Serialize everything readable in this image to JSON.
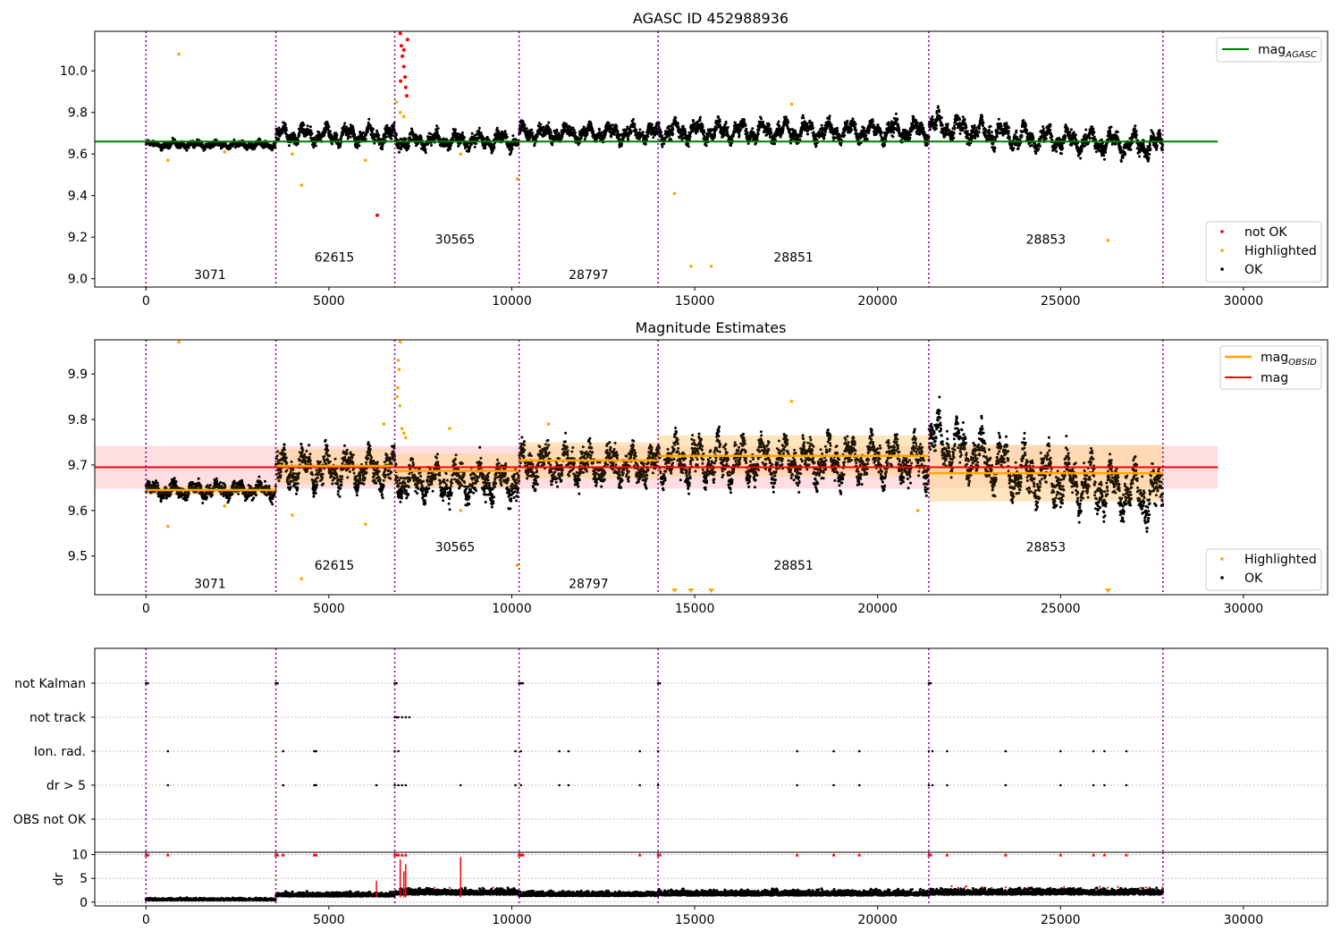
{
  "colors": {
    "ok": "#000000",
    "highlighted": "#FFA500",
    "not_ok": "#FF0000",
    "mag_agasc_line": "#008000",
    "mag_line": "#FF0000",
    "mag_obsid_line": "#FFA500",
    "band_mag": "#FFB6BE",
    "band_obsid": "#FFE3BF",
    "obs_separator": "#800080",
    "grid": "#b0b0b0"
  },
  "chart_data": [
    {
      "id": "agasc",
      "type": "scatter",
      "title": "AGASC ID 452988936",
      "xlim": [
        -1400,
        32300
      ],
      "ylim": [
        8.96,
        10.19
      ],
      "xticks": [
        0,
        5000,
        10000,
        15000,
        20000,
        25000,
        30000
      ],
      "yticks": [
        9.0,
        9.2,
        9.4,
        9.6,
        9.8,
        10.0
      ],
      "ytick_labels": [
        "9.0",
        "9.2",
        "9.4",
        "9.6",
        "9.8",
        "10.0"
      ],
      "obs_boundaries": [
        0,
        3550,
        6800,
        10200,
        14000,
        21400,
        27800
      ],
      "obs_labels": [
        {
          "text": "3071",
          "x": 1750,
          "y": 9.02
        },
        {
          "text": "62615",
          "x": 5150,
          "y": 9.105
        },
        {
          "text": "30565",
          "x": 8450,
          "y": 9.19
        },
        {
          "text": "28797",
          "x": 12100,
          "y": 9.02
        },
        {
          "text": "28851",
          "x": 17700,
          "y": 9.105
        },
        {
          "text": "28853",
          "x": 24600,
          "y": 9.19
        }
      ],
      "mag_agasc": 9.66,
      "mag_agasc_span": [
        -1400,
        29300
      ],
      "segments": [
        {
          "x0": 0,
          "x1": 3550,
          "base": 9.645,
          "amp": 0.015,
          "noise": 0.02
        },
        {
          "x0": 3550,
          "x1": 6800,
          "base": 9.69,
          "amp": 0.045,
          "noise": 0.04
        },
        {
          "x0": 6800,
          "x1": 10200,
          "base": 9.665,
          "amp": 0.04,
          "noise": 0.04
        },
        {
          "x0": 10200,
          "x1": 14000,
          "base": 9.7,
          "amp": 0.04,
          "noise": 0.04
        },
        {
          "x0": 14000,
          "x1": 21400,
          "base": 9.71,
          "amp": 0.05,
          "noise": 0.045
        },
        {
          "x0": 21400,
          "x1": 27800,
          "base": 9.68,
          "amp": 0.06,
          "noise": 0.05
        }
      ],
      "highlighted_points": [
        [
          900,
          10.08
        ],
        [
          600,
          9.57
        ],
        [
          4000,
          9.6
        ],
        [
          4250,
          9.45
        ],
        [
          6000,
          9.57
        ],
        [
          8600,
          9.6
        ],
        [
          10150,
          9.48
        ],
        [
          14450,
          9.41
        ],
        [
          14900,
          9.06
        ],
        [
          15450,
          9.06
        ],
        [
          17650,
          9.84
        ],
        [
          26300,
          9.185
        ],
        [
          6850,
          9.85
        ],
        [
          6950,
          9.8
        ],
        [
          7050,
          9.78
        ],
        [
          2150,
          9.61
        ]
      ],
      "not_ok_points": [
        [
          6320,
          9.305
        ],
        [
          6950,
          10.18
        ],
        [
          6980,
          10.12
        ],
        [
          7010,
          10.07
        ],
        [
          7050,
          10.02
        ],
        [
          7080,
          9.97
        ],
        [
          7100,
          9.92
        ],
        [
          7130,
          9.88
        ],
        [
          7150,
          10.15
        ],
        [
          7050,
          10.1
        ],
        [
          6960,
          9.95
        ]
      ],
      "legend_top": [
        "mag_AGASC"
      ],
      "legend_bottom": [
        "not OK",
        "Highlighted",
        "OK"
      ]
    },
    {
      "id": "estimates",
      "type": "scatter",
      "title": "Magnitude Estimates",
      "xlim": [
        -1400,
        32300
      ],
      "ylim": [
        9.415,
        9.975
      ],
      "xticks": [
        0,
        5000,
        10000,
        15000,
        20000,
        25000,
        30000
      ],
      "yticks": [
        9.5,
        9.6,
        9.7,
        9.8,
        9.9
      ],
      "ytick_labels": [
        "9.5",
        "9.6",
        "9.7",
        "9.8",
        "9.9"
      ],
      "obs_boundaries": [
        0,
        3550,
        6800,
        10200,
        14000,
        21400,
        27800
      ],
      "obs_labels": [
        {
          "text": "3071",
          "x": 1750,
          "y": 9.44
        },
        {
          "text": "62615",
          "x": 5150,
          "y": 9.48
        },
        {
          "text": "30565",
          "x": 8450,
          "y": 9.52
        },
        {
          "text": "28797",
          "x": 12100,
          "y": 9.44
        },
        {
          "text": "28851",
          "x": 17700,
          "y": 9.48
        },
        {
          "text": "28853",
          "x": 24600,
          "y": 9.52
        }
      ],
      "mag": 9.695,
      "mag_band": [
        9.648,
        9.742
      ],
      "mag_span": [
        -1400,
        29300
      ],
      "mag_obsid": [
        {
          "x0": 0,
          "x1": 3550,
          "value": 9.645,
          "band": [
            9.635,
            9.655
          ]
        },
        {
          "x0": 3550,
          "x1": 6800,
          "value": 9.698,
          "band": [
            9.66,
            9.735
          ]
        },
        {
          "x0": 6800,
          "x1": 10200,
          "value": 9.687,
          "band": [
            9.65,
            9.725
          ]
        },
        {
          "x0": 10200,
          "x1": 14000,
          "value": 9.71,
          "band": [
            9.67,
            9.75
          ]
        },
        {
          "x0": 14000,
          "x1": 21400,
          "value": 9.72,
          "band": [
            9.675,
            9.765
          ]
        },
        {
          "x0": 21400,
          "x1": 27800,
          "value": 9.682,
          "band": [
            9.62,
            9.745
          ]
        }
      ],
      "segments": [
        {
          "x0": 0,
          "x1": 3550,
          "base": 9.645,
          "amp": 0.015,
          "noise": 0.02
        },
        {
          "x0": 3550,
          "x1": 6800,
          "base": 9.69,
          "amp": 0.045,
          "noise": 0.04
        },
        {
          "x0": 6800,
          "x1": 10200,
          "base": 9.665,
          "amp": 0.04,
          "noise": 0.04
        },
        {
          "x0": 10200,
          "x1": 14000,
          "base": 9.7,
          "amp": 0.04,
          "noise": 0.04
        },
        {
          "x0": 14000,
          "x1": 21400,
          "base": 9.71,
          "amp": 0.05,
          "noise": 0.045
        },
        {
          "x0": 21400,
          "x1": 27800,
          "base": 9.68,
          "amp": 0.06,
          "noise": 0.05
        }
      ],
      "highlighted_points": [
        [
          900,
          9.97
        ],
        [
          600,
          9.565
        ],
        [
          4000,
          9.59
        ],
        [
          4250,
          9.45
        ],
        [
          6000,
          9.57
        ],
        [
          6500,
          9.79
        ],
        [
          6950,
          9.97
        ],
        [
          6900,
          9.93
        ],
        [
          6920,
          9.91
        ],
        [
          6880,
          9.87
        ],
        [
          6860,
          9.85
        ],
        [
          6940,
          9.83
        ],
        [
          7000,
          9.78
        ],
        [
          7050,
          9.77
        ],
        [
          7100,
          9.76
        ],
        [
          8300,
          9.78
        ],
        [
          8600,
          9.6
        ],
        [
          10150,
          9.48
        ],
        [
          11000,
          9.79
        ],
        [
          17650,
          9.84
        ],
        [
          21100,
          9.6
        ],
        [
          2150,
          9.61
        ]
      ],
      "below_range_markers": [
        14450,
        14900,
        15450,
        26300
      ],
      "legend_top": [
        "mag_OBSID",
        "mag"
      ],
      "legend_bottom": [
        "Highlighted",
        "OK"
      ]
    },
    {
      "id": "flags",
      "type": "scatter",
      "xlim": [
        -1400,
        32300
      ],
      "categories": [
        "not Kalman",
        "not track",
        "Ion. rad.",
        "dr > 5",
        "OBS not OK"
      ],
      "obs_boundaries": [
        0,
        3550,
        6800,
        10200,
        14000,
        21400,
        27800
      ],
      "flag_points": {
        "not Kalman": [
          0,
          50,
          3550,
          3600,
          6800,
          6850,
          10200,
          10250,
          10300,
          14000,
          14050,
          21400,
          21450
        ],
        "not track": [
          6800,
          6850,
          6900,
          7000,
          7100,
          7200
        ],
        "Ion. rad.": [
          600,
          3750,
          4600,
          4650,
          6800,
          6900,
          10100,
          10250,
          11300,
          11550,
          13500,
          14000,
          17800,
          18800,
          19500,
          21400,
          21500,
          21900,
          23500,
          25000,
          25900,
          26200,
          26800
        ],
        "dr > 5": [
          600,
          3750,
          4600,
          4650,
          6300,
          6800,
          6900,
          7000,
          7100,
          8600,
          10100,
          10250,
          11300,
          11550,
          13500,
          14000,
          17800,
          18800,
          19500,
          21400,
          21500,
          21900,
          23500,
          25000,
          25900,
          26200,
          26800
        ],
        "OBS not OK": []
      }
    },
    {
      "id": "dr",
      "type": "scatter",
      "ylabel": "dr",
      "xlim": [
        -1400,
        32300
      ],
      "ylim": [
        -0.8,
        10.5
      ],
      "xticks": [
        0,
        5000,
        10000,
        15000,
        20000,
        25000,
        30000
      ],
      "yticks": [
        0,
        5,
        10
      ],
      "ytick_labels": [
        "0",
        "5",
        "10"
      ],
      "obs_boundaries": [
        0,
        3550,
        6800,
        10200,
        14000,
        21400,
        27800
      ],
      "segments": [
        {
          "x0": 0,
          "x1": 3550,
          "base": 0.4,
          "spread": 0.5
        },
        {
          "x0": 3550,
          "x1": 6800,
          "base": 1.2,
          "spread": 1.0
        },
        {
          "x0": 6800,
          "x1": 10200,
          "base": 1.6,
          "spread": 1.4
        },
        {
          "x0": 10200,
          "x1": 14000,
          "base": 1.3,
          "spread": 1.1
        },
        {
          "x0": 14000,
          "x1": 21400,
          "base": 1.4,
          "spread": 1.3
        },
        {
          "x0": 21400,
          "x1": 27800,
          "base": 1.6,
          "spread": 1.5
        }
      ],
      "capped_points": [
        0,
        50,
        600,
        3550,
        3600,
        3750,
        4600,
        4650,
        6800,
        6850,
        6900,
        7000,
        7100,
        10200,
        10250,
        10300,
        13500,
        14000,
        14050,
        17800,
        18800,
        19500,
        21400,
        21450,
        21900,
        23500,
        25000,
        25900,
        26200,
        26800
      ],
      "spike_points": [
        [
          6300,
          4.5
        ],
        [
          7050,
          6.5
        ],
        [
          7100,
          8.0
        ],
        [
          8600,
          9.5
        ],
        [
          6950,
          9.0
        ]
      ]
    }
  ]
}
